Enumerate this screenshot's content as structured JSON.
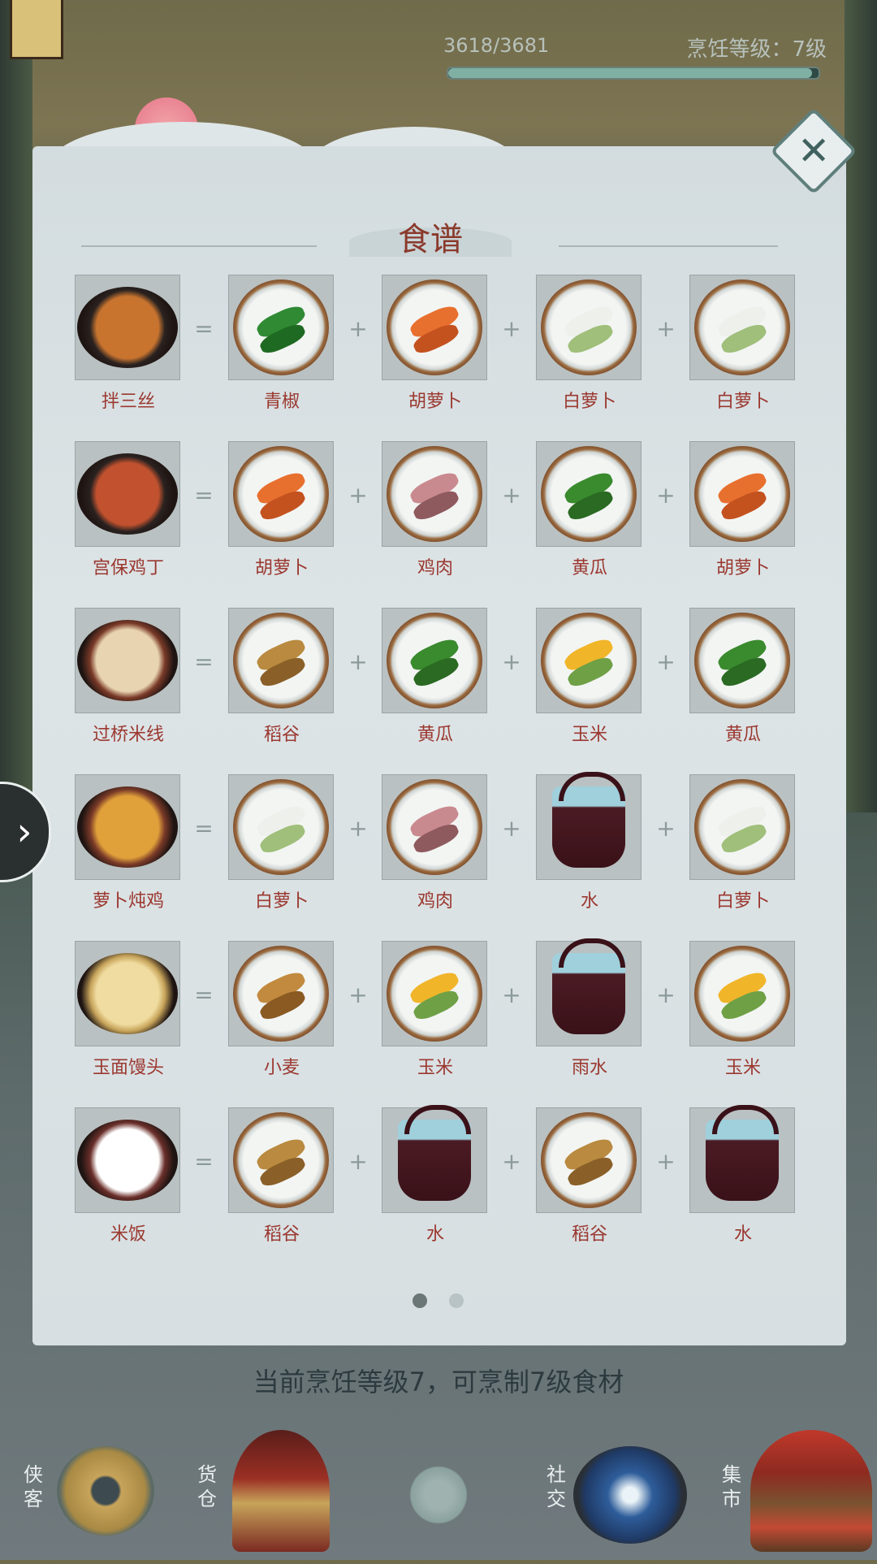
{
  "top": {
    "progress_text": "3618/3681",
    "progress_fraction": 0.983,
    "level_text": "烹饪等级：7级"
  },
  "panel": {
    "title": "食谱",
    "close_icon": "close-icon",
    "operators": {
      "equals": "=",
      "plus": "+"
    }
  },
  "recipes": [
    {
      "dish": "拌三丝",
      "ingredients": [
        "青椒",
        "胡萝卜",
        "白萝卜",
        "白萝卜"
      ]
    },
    {
      "dish": "宫保鸡丁",
      "ingredients": [
        "胡萝卜",
        "鸡肉",
        "黄瓜",
        "胡萝卜"
      ]
    },
    {
      "dish": "过桥米线",
      "ingredients": [
        "稻谷",
        "黄瓜",
        "玉米",
        "黄瓜"
      ]
    },
    {
      "dish": "萝卜炖鸡",
      "ingredients": [
        "白萝卜",
        "鸡肉",
        "水",
        "白萝卜"
      ]
    },
    {
      "dish": "玉面馒头",
      "ingredients": [
        "小麦",
        "玉米",
        "雨水",
        "玉米"
      ]
    },
    {
      "dish": "米饭",
      "ingredients": [
        "稻谷",
        "水",
        "稻谷",
        "水"
      ]
    }
  ],
  "pager": {
    "pages": 2,
    "current": 1
  },
  "hint": "当前烹饪等级7，可烹制7级食材",
  "side_arrow": "›",
  "nav": [
    {
      "label": "侠客"
    },
    {
      "label": "货仓"
    },
    {
      "label": ""
    },
    {
      "label": "社交"
    },
    {
      "label": "集市"
    }
  ],
  "colors": {
    "accent_red": "#9b3830",
    "title": "#8a3a2c",
    "panel": "#d7dfe2"
  }
}
